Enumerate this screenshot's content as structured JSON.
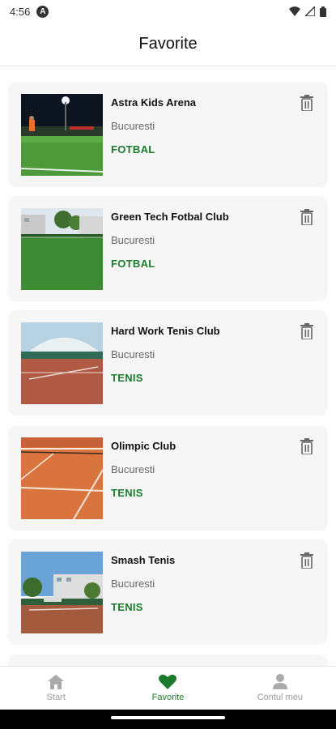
{
  "status_bar": {
    "time": "4:56",
    "a_glyph": "A"
  },
  "header": {
    "title": "Favorite"
  },
  "favorites": [
    {
      "name": "Astra Kids Arena",
      "city": "Bucuresti",
      "sport": "FOTBAL",
      "image": "football-field-night-photo"
    },
    {
      "name": "Green Tech Fotbal Club",
      "city": "Bucuresti",
      "sport": "FOTBAL",
      "image": "football-field-day-photo"
    },
    {
      "name": "Hard Work Tenis Club",
      "city": "Bucuresti",
      "sport": "TENIS",
      "image": "covered-tennis-court-photo"
    },
    {
      "name": "Olimpic Club",
      "city": "Bucuresti",
      "sport": "TENIS",
      "image": "clay-tennis-court-photo"
    },
    {
      "name": "Smash Tenis",
      "city": "Bucuresti",
      "sport": "TENIS",
      "image": "outdoor-tennis-court-photo"
    }
  ],
  "nav": [
    {
      "label": "Start",
      "icon": "home-icon",
      "active": false
    },
    {
      "label": "Favorite",
      "icon": "heart-icon",
      "active": true
    },
    {
      "label": "Contul meu",
      "icon": "person-icon",
      "active": false
    }
  ],
  "colors": {
    "accent": "#1b7a2c",
    "card_bg": "#f6f6f6",
    "inactive": "#999999"
  }
}
